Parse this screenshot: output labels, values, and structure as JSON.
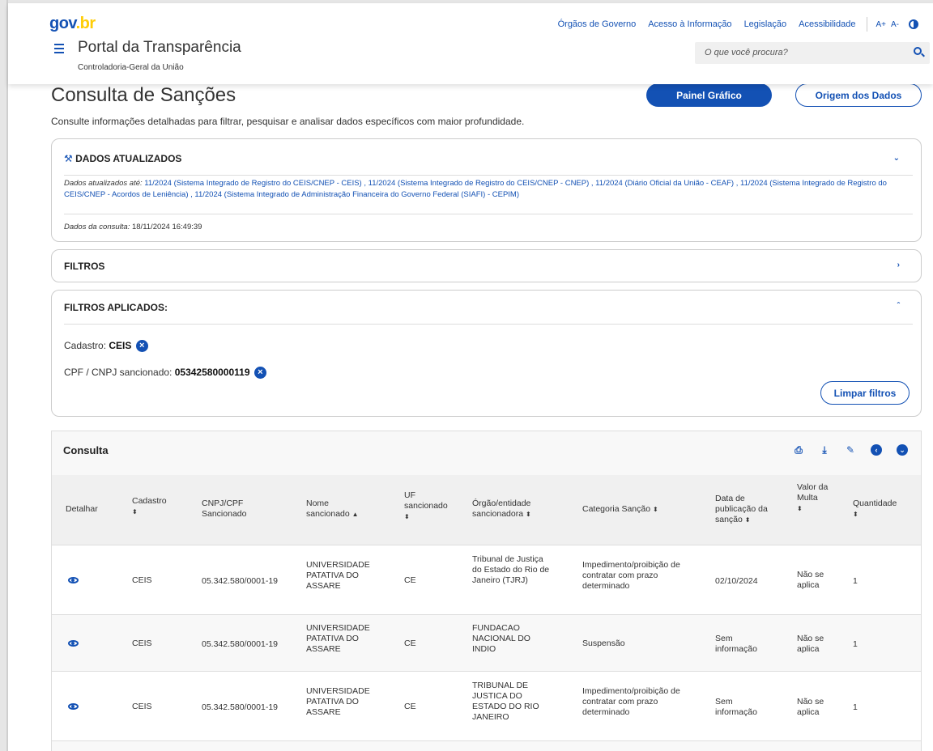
{
  "header": {
    "logo_gov": "gov",
    "logo_br": ".br",
    "nav": [
      "Órgãos de Governo",
      "Acesso à Informação",
      "Legislação",
      "Acessibilidade"
    ],
    "font_increase": "A+",
    "font_decrease": "A-",
    "portal_title": "Portal da Transparência",
    "portal_subtitle": "Controladoria-Geral da União",
    "search_placeholder": "O que você procura?"
  },
  "page": {
    "title": "Consulta de Sanções",
    "description": "Consulte informações detalhadas para filtrar, pesquisar e analisar dados específicos com maior profundidade.",
    "painel_button": "Painel Gráfico",
    "origem_button": "Origem dos Dados"
  },
  "updated": {
    "heading": "DADOS ATUALIZADOS",
    "label": "Dados atualizados até:",
    "text": " 11/2024 (Sistema Integrado de Registro do CEIS/CNEP - CEIS) , 11/2024 (Sistema Integrado de Registro do CEIS/CNEP - CNEP) , 11/2024 (Diário Oficial da União - CEAF) , 11/2024 (Sistema Integrado de Registro do CEIS/CNEP - Acordos de Leniência) , 11/2024 (Sistema Integrado de Administração Financeira do Governo Federal (SIAFI) - CEPIM)",
    "consulta_label": "Dados da consulta:",
    "consulta_value": " 18/11/2024 16:49:39"
  },
  "filters": {
    "heading": "FILTROS"
  },
  "applied": {
    "heading": "FILTROS APLICADOS:",
    "cadastro_label": "Cadastro: ",
    "cadastro_value": "CEIS",
    "cpf_label": "CPF / CNPJ sancionado: ",
    "cpf_value": "05342580000119",
    "clear_button": "Limpar filtros"
  },
  "table": {
    "title": "Consulta",
    "headers": {
      "detalhar": "Detalhar",
      "cadastro": "Cadastro",
      "cnpj": "CNPJ/CPF Sancionado",
      "nome": "Nome sancionado",
      "uf": "UF sancionado",
      "orgao": "Órgão/entidade sancionadora",
      "categoria": "Categoria Sanção",
      "data": "Data de publicação da sanção",
      "valor": "Valor da Multa",
      "quantidade": "Quantidade"
    },
    "rows": [
      {
        "cadastro": "CEIS",
        "cnpj": "05.342.580/0001-19",
        "nome": "UNIVERSIDADE PATATIVA DO ASSARE",
        "uf": "CE",
        "orgao": "Tribunal de Justiça do Estado do Rio de Janeiro (TJRJ)",
        "categoria": "Impedimento/proibição de contratar com prazo determinado",
        "data": "02/10/2024",
        "valor": "Não se aplica",
        "quantidade": "1"
      },
      {
        "cadastro": "CEIS",
        "cnpj": "05.342.580/0001-19",
        "nome": "UNIVERSIDADE PATATIVA DO ASSARE",
        "uf": "CE",
        "orgao": "FUNDACAO NACIONAL DO INDIO",
        "categoria": "Suspensão",
        "data": "Sem informação",
        "valor": "Não se aplica",
        "quantidade": "1"
      },
      {
        "cadastro": "CEIS",
        "cnpj": "05.342.580/0001-19",
        "nome": "UNIVERSIDADE PATATIVA DO ASSARE",
        "uf": "CE",
        "orgao": "TRIBUNAL DE JUSTICA DO ESTADO DO RIO JANEIRO",
        "categoria": "Impedimento/proibição de contratar com prazo determinado",
        "data": "Sem informação",
        "valor": "Não se aplica",
        "quantidade": "1"
      }
    ]
  },
  "colors": {
    "primary": "#1351b4",
    "brand_yellow": "#ffcd07"
  }
}
